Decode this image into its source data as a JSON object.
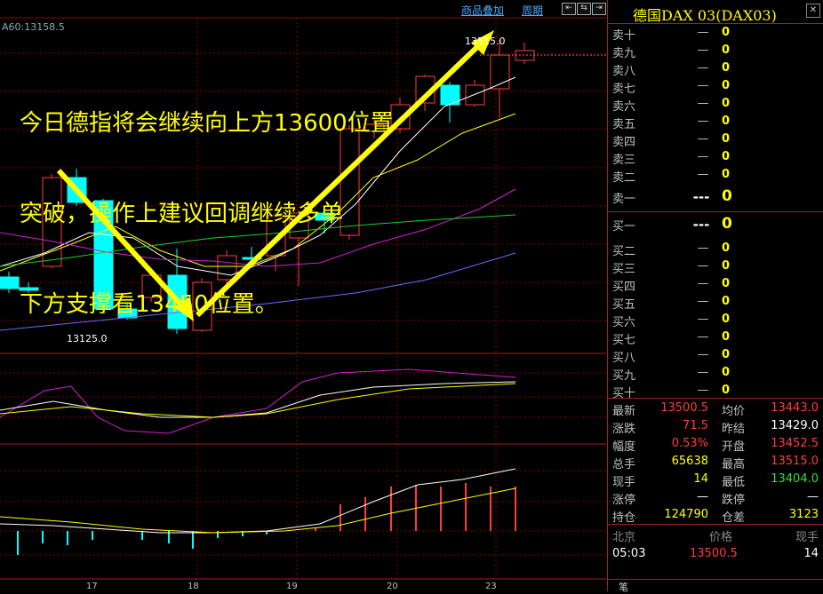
{
  "toolbar": {
    "overlay_link": "商品叠加",
    "period_link": "周期",
    "btn_a": "⇤",
    "btn_b": "⇆",
    "btn_c": "⇥"
  },
  "chart": {
    "ma_label": "A60:13158.5",
    "annotation_lines": [
      "今日德指将会继续向上方13600位置",
      "突破，操作上建议回调继续多单",
      "下方支撑看13450位置。"
    ],
    "high_label": "13515.0",
    "low_label": "13125.0",
    "x_ticks": [
      "17",
      "18",
      "19",
      "20",
      "23"
    ]
  },
  "chart_data": {
    "type": "candlestick",
    "sessions": [
      "17",
      "18",
      "19",
      "20",
      "23"
    ],
    "price_high_marker": 13515.0,
    "price_low_marker": 13125.0,
    "ma60": 13158.5
  },
  "sidebar": {
    "title": "德国DAX 03(DAX03)",
    "asks": [
      {
        "label": "卖十",
        "price": "—",
        "qty": "0"
      },
      {
        "label": "卖九",
        "price": "—",
        "qty": "0"
      },
      {
        "label": "卖八",
        "price": "—",
        "qty": "0"
      },
      {
        "label": "卖七",
        "price": "—",
        "qty": "0"
      },
      {
        "label": "卖六",
        "price": "—",
        "qty": "0"
      },
      {
        "label": "卖五",
        "price": "—",
        "qty": "0"
      },
      {
        "label": "卖四",
        "price": "—",
        "qty": "0"
      },
      {
        "label": "卖三",
        "price": "—",
        "qty": "0"
      },
      {
        "label": "卖二",
        "price": "—",
        "qty": "0"
      },
      {
        "label": "卖一",
        "price": "---",
        "qty": "0"
      }
    ],
    "bids": [
      {
        "label": "买一",
        "price": "---",
        "qty": "0"
      },
      {
        "label": "买二",
        "price": "—",
        "qty": "0"
      },
      {
        "label": "买三",
        "price": "—",
        "qty": "0"
      },
      {
        "label": "买四",
        "price": "—",
        "qty": "0"
      },
      {
        "label": "买五",
        "price": "—",
        "qty": "0"
      },
      {
        "label": "买六",
        "price": "—",
        "qty": "0"
      },
      {
        "label": "买七",
        "price": "—",
        "qty": "0"
      },
      {
        "label": "买八",
        "price": "—",
        "qty": "0"
      },
      {
        "label": "买九",
        "price": "—",
        "qty": "0"
      },
      {
        "label": "买十",
        "price": "—",
        "qty": "0"
      }
    ],
    "stats": [
      {
        "l1": "最新",
        "v1": "13500.5",
        "c1": "red",
        "l2": "均价",
        "v2": "13443.0",
        "c2": "red"
      },
      {
        "l1": "涨跌",
        "v1": "71.5",
        "c1": "red",
        "l2": "昨结",
        "v2": "13429.0",
        "c2": "white"
      },
      {
        "l1": "幅度",
        "v1": "0.53%",
        "c1": "red",
        "l2": "开盘",
        "v2": "13452.5",
        "c2": "red"
      },
      {
        "l1": "总手",
        "v1": "65638",
        "c1": "yellow",
        "l2": "最高",
        "v2": "13515.0",
        "c2": "red"
      },
      {
        "l1": "现手",
        "v1": "14",
        "c1": "yellow",
        "l2": "最低",
        "v2": "13404.0",
        "c2": "green"
      },
      {
        "l1": "涨停",
        "v1": "—",
        "c1": "white",
        "l2": "跌停",
        "v2": "—",
        "c2": "white"
      },
      {
        "l1": "持仓",
        "v1": "124790",
        "c1": "yellow",
        "l2": "仓差",
        "v2": "3123",
        "c2": "yellow"
      }
    ],
    "tick_head": {
      "place": "北京",
      "price": "价格",
      "vol": "现手"
    },
    "tick_row": {
      "time": "05:03",
      "price": "13500.5",
      "vol": "14"
    },
    "footer": "笔"
  },
  "colors": {
    "up": "#ff3c3c",
    "down": "#00ffff",
    "grid": "#8b0000",
    "annotation": "#ffff00"
  }
}
